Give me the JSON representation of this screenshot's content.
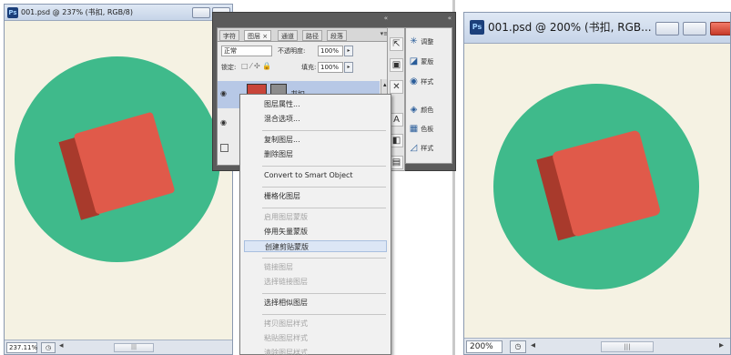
{
  "colors": {
    "canvas_bg": "#f5f2e3",
    "circle": "#3fba8b",
    "book_cover": "#e05a4a",
    "book_spine": "#a83a2c",
    "panel_dark": "#5b5b5b",
    "menu_highlight": "#dce6f5"
  },
  "left_window": {
    "title": "001.psd @ 237% (书扣, RGB/8)",
    "zoom": "237.11%",
    "scroll_thumb": "|||"
  },
  "right_window": {
    "title": "001.psd @ 200% (书扣, RGB...",
    "zoom": "200%",
    "scroll_thumb": "|||"
  },
  "layers_panel": {
    "tabs": [
      "字符",
      "图层 ×",
      "通道",
      "路径",
      "段落"
    ],
    "menu_icon": "▾≡",
    "blend_mode": "正常",
    "opacity_label": "不透明度:",
    "opacity_value": "100%",
    "lock_label": "锁定:",
    "fill_label": "填充:",
    "fill_value": "100%",
    "layer_name": "书扣"
  },
  "tool_strip": [
    {
      "icon": "pointer-tool-icon",
      "glyph": "⇱"
    },
    {
      "icon": "image-tool-icon",
      "glyph": "▣"
    },
    {
      "icon": "transform-tool-icon",
      "glyph": "✕"
    },
    {
      "icon": "text-tool-icon",
      "glyph": "A"
    },
    {
      "icon": "shape-tool-icon",
      "glyph": "◧"
    },
    {
      "icon": "layers-tool-icon",
      "glyph": "▤"
    }
  ],
  "adjust_panel": [
    {
      "icon": "sparkle-icon",
      "glyph": "✳",
      "label": "调整"
    },
    {
      "icon": "landscape-icon",
      "glyph": "◪",
      "label": "蒙版"
    },
    {
      "icon": "circle-icon",
      "glyph": "◉",
      "label": "样式"
    },
    {
      "icon": "palette-icon",
      "glyph": "◈",
      "label": "颜色"
    },
    {
      "icon": "grid-icon",
      "glyph": "▦",
      "label": "色板"
    },
    {
      "icon": "brush-icon",
      "glyph": "◿",
      "label": "样式"
    }
  ],
  "context_menu": [
    {
      "label": "图层属性...",
      "state": "normal"
    },
    {
      "label": "混合选项...",
      "state": "normal"
    },
    {
      "sep": true
    },
    {
      "label": "复制图层...",
      "state": "normal"
    },
    {
      "label": "删除图层",
      "state": "normal"
    },
    {
      "sep": true
    },
    {
      "label": "Convert to Smart Object",
      "state": "normal"
    },
    {
      "sep": true
    },
    {
      "label": "栅格化图层",
      "state": "normal"
    },
    {
      "sep": true
    },
    {
      "label": "启用图层蒙版",
      "state": "disabled"
    },
    {
      "label": "停用矢量蒙版",
      "state": "normal"
    },
    {
      "label": "创建剪贴蒙版",
      "state": "highlighted"
    },
    {
      "sep": true
    },
    {
      "label": "链接图层",
      "state": "disabled"
    },
    {
      "label": "选择链接图层",
      "state": "disabled"
    },
    {
      "sep": true
    },
    {
      "label": "选择相似图层",
      "state": "normal"
    },
    {
      "sep": true
    },
    {
      "label": "拷贝图层样式",
      "state": "disabled"
    },
    {
      "label": "粘贴图层样式",
      "state": "disabled"
    },
    {
      "label": "清除图层样式",
      "state": "disabled"
    }
  ]
}
